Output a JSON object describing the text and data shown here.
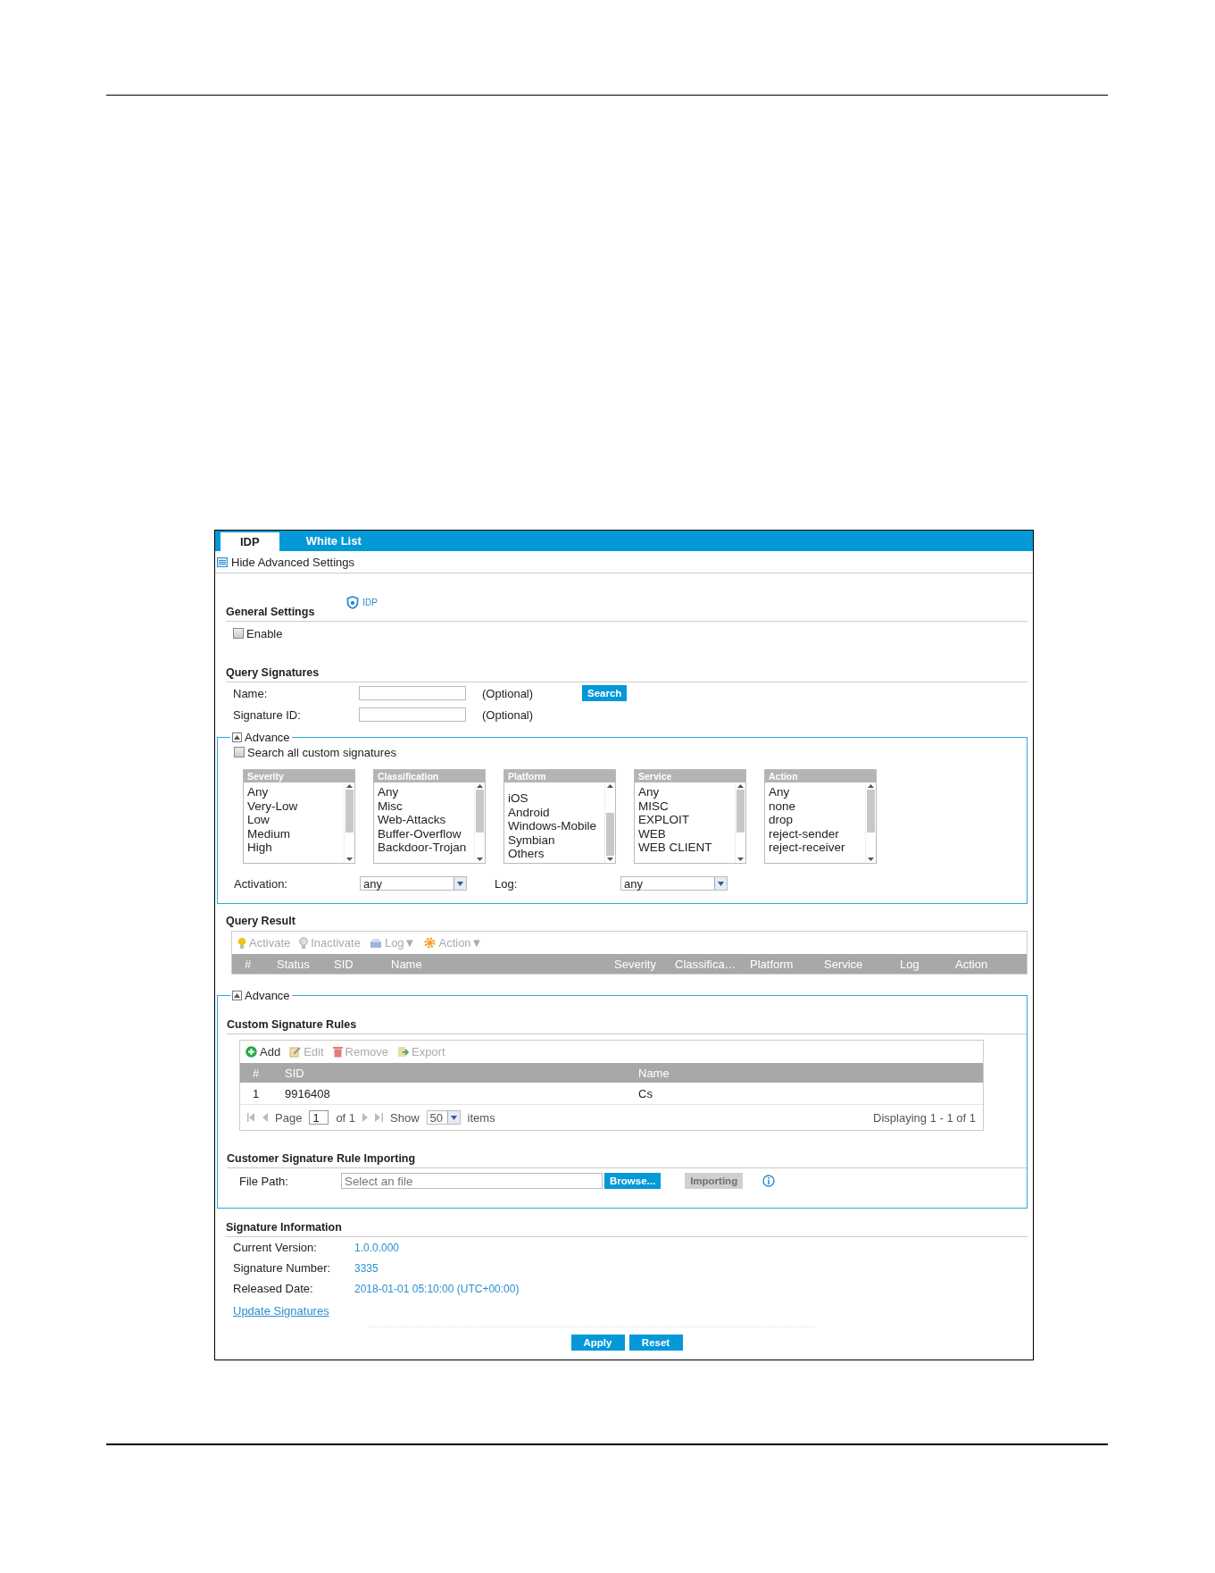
{
  "tabs": [
    {
      "label": "IDP",
      "selected": true
    },
    {
      "label": "White List",
      "selected": false
    }
  ],
  "hide_advanced": "Hide Advanced Settings",
  "general_settings": {
    "title": "General Settings",
    "idp_link": "IDP",
    "enable": {
      "label": "Enable",
      "checked": false
    }
  },
  "query_signatures": {
    "title": "Query Signatures",
    "search_button": "Search",
    "fields": [
      {
        "label": "Name:",
        "hint": "(Optional)"
      },
      {
        "label": "Signature ID:",
        "hint": "(Optional)"
      }
    ]
  },
  "query_advance": {
    "legend": "Advance",
    "expanded": true,
    "search_all": {
      "label": "Search all custom signatures",
      "checked": false
    },
    "lists": [
      {
        "header": "Severity",
        "scrolled": false,
        "items": [
          "Any",
          "Very-Low",
          "Low",
          "Medium",
          "High"
        ]
      },
      {
        "header": "Classification",
        "scrolled": false,
        "items": [
          "Any",
          "Misc",
          "Web-Attacks",
          "Buffer-Overflow",
          "Backdoor-Trojan"
        ]
      },
      {
        "header": "Platform",
        "scrolled": true,
        "items": [
          "iOS",
          "Android",
          "Windows-Mobile",
          "Symbian",
          "Others"
        ]
      },
      {
        "header": "Service",
        "scrolled": false,
        "items": [
          "Any",
          "MISC",
          "EXPLOIT",
          "WEB",
          "WEB CLIENT"
        ]
      },
      {
        "header": "Action",
        "scrolled": false,
        "items": [
          "Any",
          "none",
          "drop",
          "reject-sender",
          "reject-receiver"
        ]
      }
    ],
    "activation": {
      "label": "Activation:",
      "value": "any"
    },
    "log": {
      "label": "Log:",
      "value": "any"
    }
  },
  "query_result": {
    "title": "Query Result",
    "toolbar": [
      {
        "label": "Activate",
        "kind": "bulb-on",
        "disabled": true
      },
      {
        "label": "Inactivate",
        "kind": "bulb-off",
        "disabled": true
      },
      {
        "label": "Log▼",
        "kind": "log",
        "disabled": true
      },
      {
        "label": "Action▼",
        "kind": "gear",
        "disabled": true
      }
    ],
    "columns": [
      "#",
      "Status",
      "SID",
      "Name",
      "Severity",
      "Classifica…",
      "Platform",
      "Service",
      "Log",
      "Action"
    ]
  },
  "custom_advance": {
    "legend": "Advance",
    "expanded": true,
    "rules": {
      "title": "Custom Signature Rules",
      "toolbar": [
        {
          "label": "Add",
          "kind": "add",
          "disabled": false
        },
        {
          "label": "Edit",
          "kind": "edit",
          "disabled": true
        },
        {
          "label": "Remove",
          "kind": "remove",
          "disabled": true
        },
        {
          "label": "Export",
          "kind": "export",
          "disabled": true
        }
      ],
      "columns": [
        "#",
        "SID",
        "Name"
      ],
      "rows": [
        [
          "1",
          "9916408",
          "Cs"
        ]
      ],
      "pager": {
        "page_label": "Page",
        "page": "1",
        "of": "of 1",
        "show": "Show",
        "per_page": "50",
        "items": "items",
        "displaying": "Displaying 1 - 1 of 1"
      }
    },
    "importing": {
      "title": "Customer Signature Rule Importing",
      "label": "File Path:",
      "placeholder": "Select an file",
      "browse": "Browse...",
      "import": "Importing",
      "import_disabled": true
    }
  },
  "signature_information": {
    "title": "Signature Information",
    "rows": [
      {
        "label": "Current Version:",
        "value": "1.0.0.000"
      },
      {
        "label": "Signature Number:",
        "value": "3335"
      },
      {
        "label": "Released Date:",
        "value": "2018-01-01 05:10:00 (UTC+00:00)"
      }
    ],
    "update_link": "Update Signatures"
  },
  "buttons": [
    "Apply",
    "Reset"
  ]
}
